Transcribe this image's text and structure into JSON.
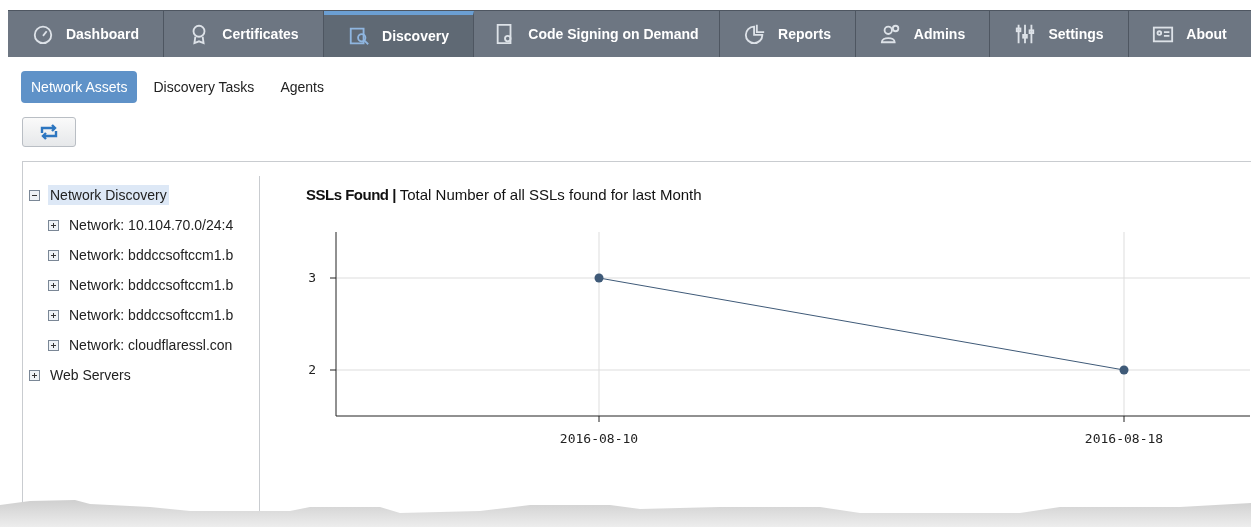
{
  "nav_tabs": [
    {
      "label": "Dashboard",
      "selected": false
    },
    {
      "label": "Certificates",
      "selected": false
    },
    {
      "label": "Discovery",
      "selected": true
    },
    {
      "label": "Code Signing on Demand",
      "selected": false
    },
    {
      "label": "Reports",
      "selected": false
    },
    {
      "label": "Admins",
      "selected": false
    },
    {
      "label": "Settings",
      "selected": false
    },
    {
      "label": "About",
      "selected": false
    }
  ],
  "sub_tabs": [
    {
      "label": "Network Assets",
      "selected": true
    },
    {
      "label": "Discovery Tasks",
      "selected": false
    },
    {
      "label": "Agents",
      "selected": false
    }
  ],
  "tree": [
    {
      "label": "Network Discovery",
      "expanded": true,
      "selected": true,
      "children": [
        {
          "label": "Network: 10.104.70.0/24:4",
          "expanded": false,
          "selected": false
        },
        {
          "label": "Network: bddccsoftccm1.b",
          "expanded": false,
          "selected": false
        },
        {
          "label": "Network: bddccsoftccm1.b",
          "expanded": false,
          "selected": false
        },
        {
          "label": "Network: bddccsoftccm1.b",
          "expanded": false,
          "selected": false
        },
        {
          "label": "Network: cloudflaressl.con",
          "expanded": false,
          "selected": false
        }
      ]
    },
    {
      "label": "Web Servers",
      "expanded": false,
      "selected": false
    }
  ],
  "chart": {
    "chart_data": {
      "type": "line",
      "title": "**SSLs Found |** Total Number of all SSLs found for last Month",
      "categories": [
        "2016-08-10",
        "2016-08-18"
      ],
      "grid": true,
      "series": [
        {
          "color": "#3f5a78",
          "marker": true,
          "values": [
            3,
            2
          ]
        }
      ],
      "ylim": [
        1.5,
        3.5
      ],
      "yticks": [
        2,
        3
      ]
    }
  }
}
